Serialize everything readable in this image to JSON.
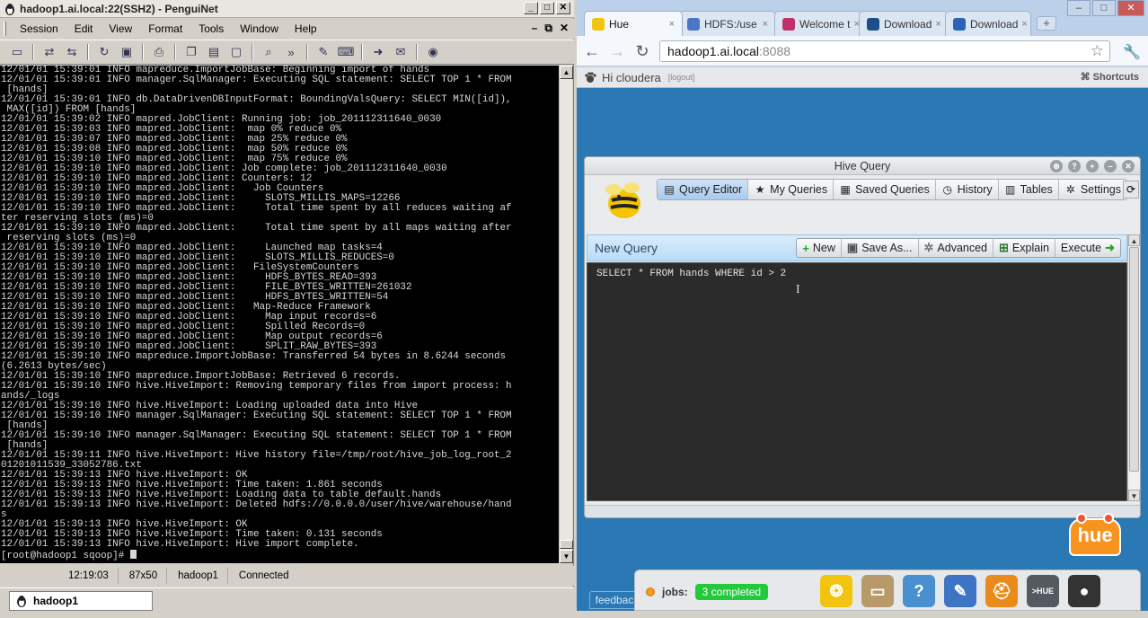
{
  "penguinet": {
    "title": "hadoop1.ai.local:22(SSH2) - PenguiNet",
    "menu": [
      "Session",
      "Edit",
      "View",
      "Format",
      "Tools",
      "Window",
      "Help"
    ],
    "terminal_lines": [
      "12/01/01 15:39:01 INFO mapreduce.ImportJobBase: Beginning import of hands",
      "12/01/01 15:39:01 INFO manager.SqlManager: Executing SQL statement: SELECT TOP 1 * FROM",
      " [hands]",
      "12/01/01 15:39:01 INFO db.DataDrivenDBInputFormat: BoundingValsQuery: SELECT MIN([id]),",
      " MAX([id]) FROM [hands]",
      "12/01/01 15:39:02 INFO mapred.JobClient: Running job: job_201112311640_0030",
      "12/01/01 15:39:03 INFO mapred.JobClient:  map 0% reduce 0%",
      "12/01/01 15:39:07 INFO mapred.JobClient:  map 25% reduce 0%",
      "12/01/01 15:39:08 INFO mapred.JobClient:  map 50% reduce 0%",
      "12/01/01 15:39:10 INFO mapred.JobClient:  map 75% reduce 0%",
      "12/01/01 15:39:10 INFO mapred.JobClient: Job complete: job_201112311640_0030",
      "12/01/01 15:39:10 INFO mapred.JobClient: Counters: 12",
      "12/01/01 15:39:10 INFO mapred.JobClient:   Job Counters",
      "12/01/01 15:39:10 INFO mapred.JobClient:     SLOTS_MILLIS_MAPS=12266",
      "12/01/01 15:39:10 INFO mapred.JobClient:     Total time spent by all reduces waiting af",
      "ter reserving slots (ms)=0",
      "12/01/01 15:39:10 INFO mapred.JobClient:     Total time spent by all maps waiting after",
      " reserving slots (ms)=0",
      "12/01/01 15:39:10 INFO mapred.JobClient:     Launched map tasks=4",
      "12/01/01 15:39:10 INFO mapred.JobClient:     SLOTS_MILLIS_REDUCES=0",
      "12/01/01 15:39:10 INFO mapred.JobClient:   FileSystemCounters",
      "12/01/01 15:39:10 INFO mapred.JobClient:     HDFS_BYTES_READ=393",
      "12/01/01 15:39:10 INFO mapred.JobClient:     FILE_BYTES_WRITTEN=261032",
      "12/01/01 15:39:10 INFO mapred.JobClient:     HDFS_BYTES_WRITTEN=54",
      "12/01/01 15:39:10 INFO mapred.JobClient:   Map-Reduce Framework",
      "12/01/01 15:39:10 INFO mapred.JobClient:     Map input records=6",
      "12/01/01 15:39:10 INFO mapred.JobClient:     Spilled Records=0",
      "12/01/01 15:39:10 INFO mapred.JobClient:     Map output records=6",
      "12/01/01 15:39:10 INFO mapred.JobClient:     SPLIT_RAW_BYTES=393",
      "12/01/01 15:39:10 INFO mapreduce.ImportJobBase: Transferred 54 bytes in 8.6244 seconds",
      "(6.2613 bytes/sec)",
      "12/01/01 15:39:10 INFO mapreduce.ImportJobBase: Retrieved 6 records.",
      "12/01/01 15:39:10 INFO hive.HiveImport: Removing temporary files from import process: h",
      "ands/_logs",
      "12/01/01 15:39:10 INFO hive.HiveImport: Loading uploaded data into Hive",
      "12/01/01 15:39:10 INFO manager.SqlManager: Executing SQL statement: SELECT TOP 1 * FROM",
      " [hands]",
      "12/01/01 15:39:10 INFO manager.SqlManager: Executing SQL statement: SELECT TOP 1 * FROM",
      " [hands]",
      "12/01/01 15:39:11 INFO hive.HiveImport: Hive history file=/tmp/root/hive_job_log_root_2",
      "01201011539_33052786.txt",
      "12/01/01 15:39:13 INFO hive.HiveImport: OK",
      "12/01/01 15:39:13 INFO hive.HiveImport: Time taken: 1.861 seconds",
      "12/01/01 15:39:13 INFO hive.HiveImport: Loading data to table default.hands",
      "12/01/01 15:39:13 INFO hive.HiveImport: Deleted hdfs://0.0.0.0/user/hive/warehouse/hand",
      "s",
      "12/01/01 15:39:13 INFO hive.HiveImport: OK",
      "12/01/01 15:39:13 INFO hive.HiveImport: Time taken: 0.131 seconds",
      "12/01/01 15:39:13 INFO hive.HiveImport: Hive import complete."
    ],
    "prompt": "[root@hadoop1 sqoop]# ",
    "status": [
      "12:19:03",
      "87x50",
      "hadoop1",
      "Connected"
    ],
    "session_tab": "hadoop1"
  },
  "chrome": {
    "tabs": [
      {
        "label": "Hue",
        "color": "#f2c40f"
      },
      {
        "label": "HDFS:/use",
        "color": "#4a76c8"
      },
      {
        "label": "Welcome t",
        "color": "#c0306a"
      },
      {
        "label": "Download",
        "color": "#1a4f8a"
      },
      {
        "label": "Download",
        "color": "#2a63b8"
      }
    ],
    "url_host": "hadoop1.ai.local",
    "url_port": ":8088"
  },
  "hue": {
    "greeting": "Hi cloudera",
    "logout": "[logout]",
    "shortcuts": "Shortcuts",
    "window_title": "Hive Query",
    "nav": [
      {
        "label": "Query Editor",
        "icon": "▤"
      },
      {
        "label": "My Queries",
        "icon": "★"
      },
      {
        "label": "Saved Queries",
        "icon": "▦"
      },
      {
        "label": "History",
        "icon": "◷"
      },
      {
        "label": "Tables",
        "icon": "▥"
      },
      {
        "label": "Settings",
        "icon": "✲"
      }
    ],
    "query_title": "New Query",
    "actions": [
      {
        "label": "New",
        "icon": "+"
      },
      {
        "label": "Save As...",
        "icon": "▣"
      },
      {
        "label": "Advanced",
        "icon": "✲"
      },
      {
        "label": "Explain",
        "icon": "⊞"
      },
      {
        "label": "Execute",
        "icon": "➜"
      }
    ],
    "sql": "SELECT * FROM hands WHERE id > 2",
    "logo_text": "hue",
    "jobs_label": "jobs:",
    "jobs_status": "3 completed",
    "feedback": "feedback",
    "dock_apps": [
      {
        "name": "beeswax-icon",
        "color": "#f2c40f",
        "glyph": "❂"
      },
      {
        "name": "file-browser-icon",
        "color": "#b89a6a",
        "glyph": "▭"
      },
      {
        "name": "help-icon",
        "color": "#4a8fd0",
        "glyph": "?"
      },
      {
        "name": "job-designer-icon",
        "color": "#3d74c4",
        "glyph": "✎"
      },
      {
        "name": "job-browser-icon",
        "color": "#e98a1a",
        "glyph": "⛑"
      },
      {
        "name": "shell-icon",
        "color": "#555a60",
        "glyph": ">HUE"
      },
      {
        "name": "user-admin-icon",
        "color": "#333333",
        "glyph": "●"
      }
    ]
  }
}
